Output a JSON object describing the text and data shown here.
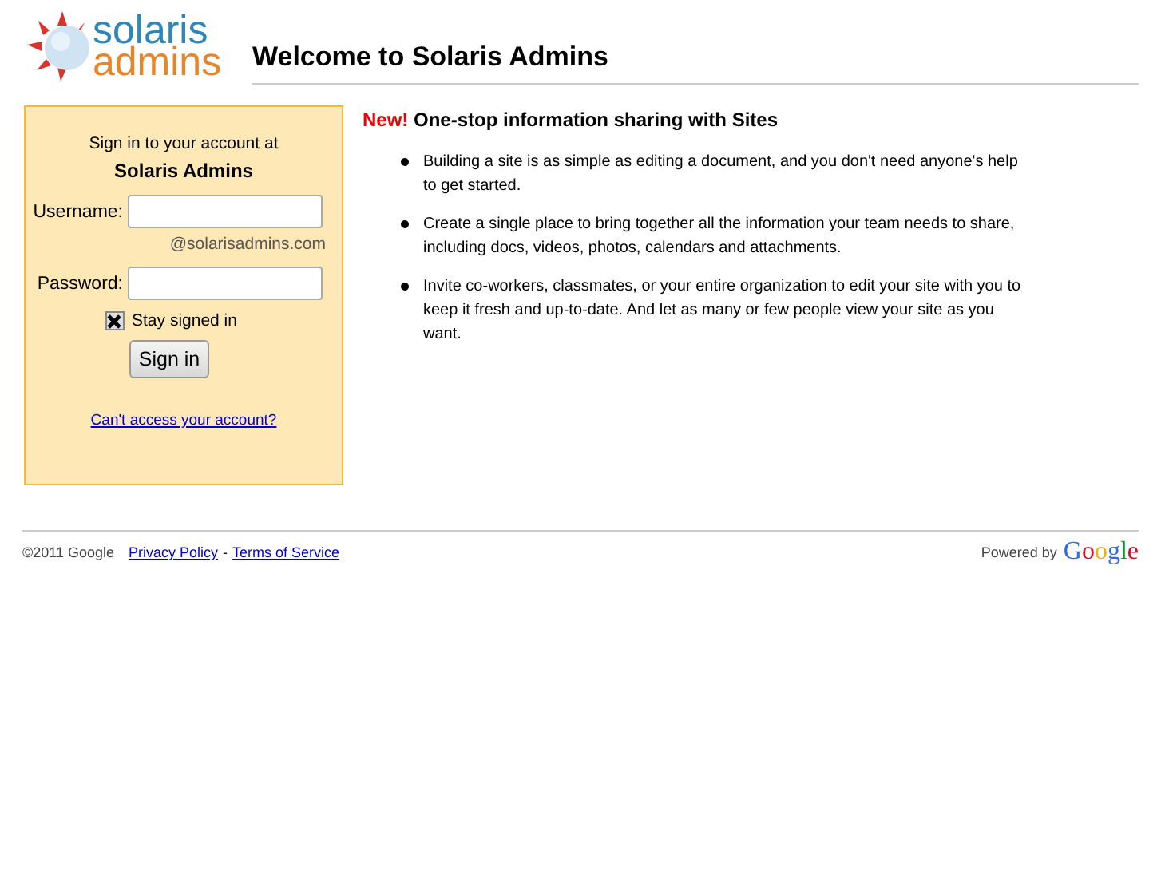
{
  "logo": {
    "line_1": "solaris",
    "line_2": "admins"
  },
  "page_title": "Welcome to Solaris Admins",
  "signin": {
    "intro": "Sign in to your account at",
    "site": "Solaris Admins",
    "username_label": "Username:",
    "domain": "@solarisadmins.com",
    "password_label": "Password:",
    "stay_signed_in": {
      "label": "Stay signed in",
      "checked": true
    },
    "button": "Sign in",
    "help_link": "Can't access your account?"
  },
  "promo": {
    "badge": "New!",
    "heading": "One-stop information sharing with Sites",
    "items": [
      "Building a site is as simple as editing a document, and you don't need anyone's help to get started.",
      "Create a single place to bring together all the information your team needs to share, including docs, videos, photos, calendars and attachments.",
      "Invite co-workers, classmates, or your entire organization to edit your site with you to keep it fresh and up-to-date. And let as many or few people view your site as you want."
    ]
  },
  "footer": {
    "copyright": "©2011 Google",
    "privacy": "Privacy Policy",
    "separator": "-",
    "terms": "Terms of Service",
    "powered_by": "Powered by",
    "brand": "Google"
  }
}
